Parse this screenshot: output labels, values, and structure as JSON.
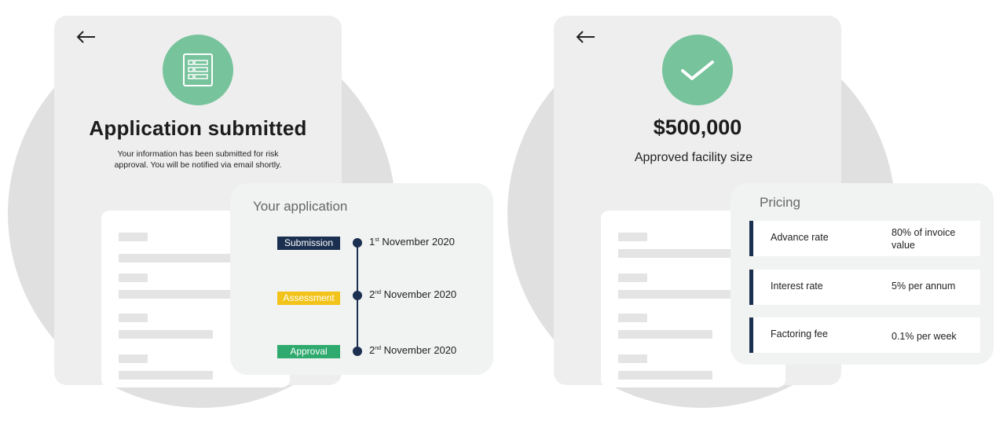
{
  "application_screen": {
    "title": "Application submitted",
    "message": "Your information has been submitted for risk approval. You will be notified via email shortly.",
    "card": {
      "title": "Your application",
      "stages": [
        {
          "label": "Submission",
          "date_day": "1",
          "date_suffix": "st",
          "date_rest": "November 2020",
          "color": "#1b3050"
        },
        {
          "label": "Assessment",
          "date_day": "2",
          "date_suffix": "nd",
          "date_rest": "November 2020",
          "color": "#f2c31a"
        },
        {
          "label": "Approval",
          "date_day": "2",
          "date_suffix": "nd",
          "date_rest": "November 2020",
          "color": "#2eaa6e"
        }
      ]
    }
  },
  "approval_screen": {
    "amount": "$500,000",
    "amount_label": "Approved facility size",
    "pricing": {
      "title": "Pricing",
      "rows": [
        {
          "label": "Advance rate",
          "value": "80% of invoice value"
        },
        {
          "label": "Interest rate",
          "value": "5% per annum"
        },
        {
          "label": "Factoring fee",
          "value": "0.1% per week"
        }
      ]
    }
  },
  "colors": {
    "accent_green": "#76c39c",
    "navy": "#1b3050",
    "background_circle": "#e0e0e0",
    "panel": "#eeeeee"
  },
  "icons": {
    "back": "back-arrow-icon",
    "application": "application-form-icon",
    "approved": "checkmark-icon"
  }
}
